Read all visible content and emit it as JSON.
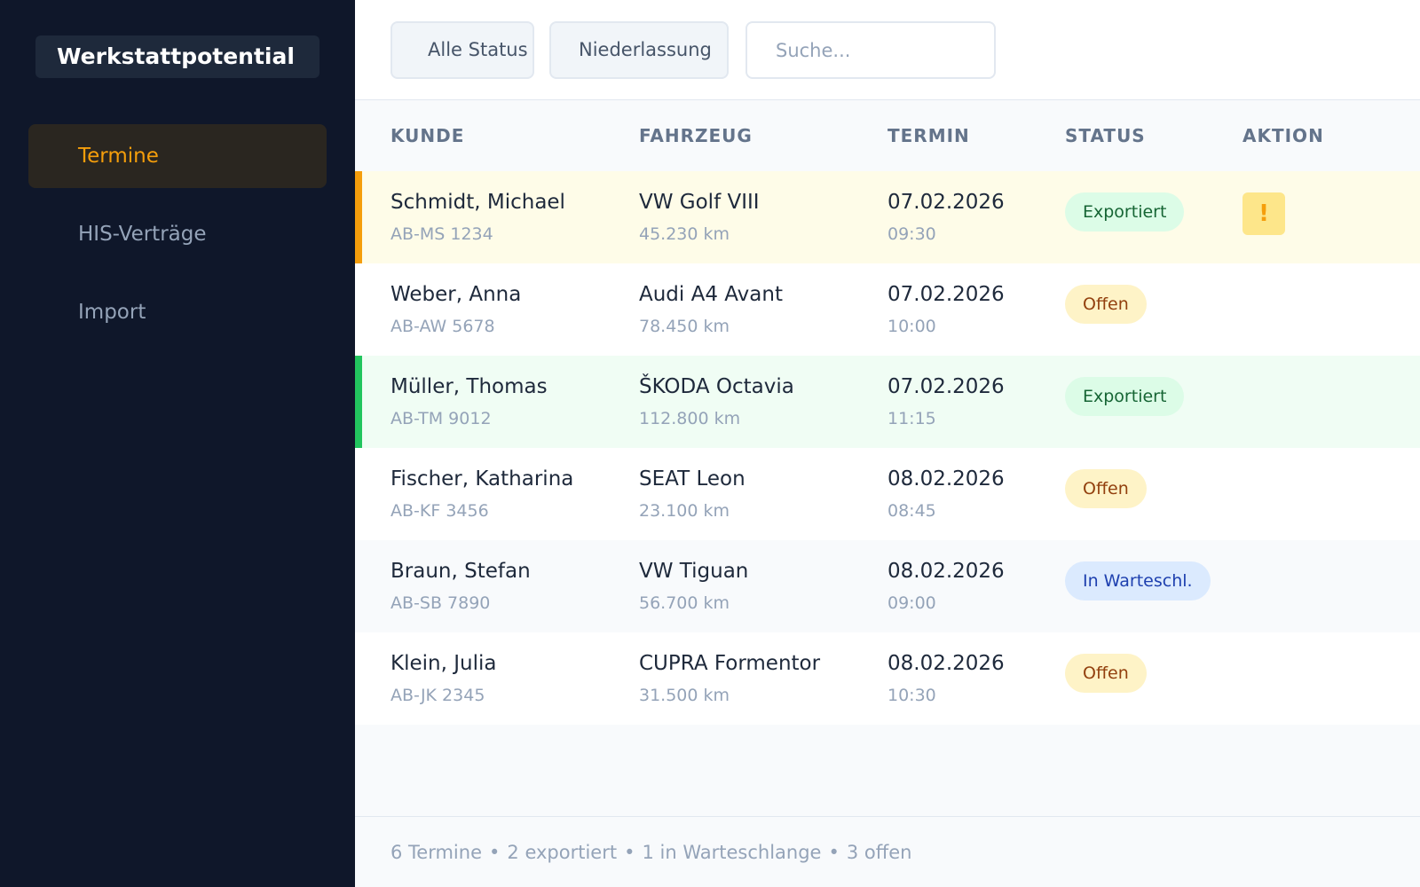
{
  "sidebar": {
    "brand": "Werkstattpotential",
    "items": [
      {
        "label": "Termine",
        "active": true
      },
      {
        "label": "HIS-Verträge",
        "active": false
      },
      {
        "label": "Import",
        "active": false
      }
    ]
  },
  "toolbar": {
    "status_filter": "Alle Status",
    "branch_filter": "Niederlassung",
    "search_placeholder": "Suche..."
  },
  "table": {
    "columns": [
      "KUNDE",
      "FAHRZEUG",
      "TERMIN",
      "STATUS",
      "AKTION"
    ],
    "rows": [
      {
        "name": "Schmidt, Michael",
        "plate": "AB-MS 1234",
        "vehicle": "VW Golf VIII",
        "mileage": "45.230 km",
        "date": "07.02.2026",
        "time": "09:30",
        "status": "Exportiert",
        "action": "!"
      },
      {
        "name": "Weber, Anna",
        "plate": "AB-AW 5678",
        "vehicle": "Audi A4 Avant",
        "mileage": "78.450 km",
        "date": "07.02.2026",
        "time": "10:00",
        "status": "Offen",
        "action": ""
      },
      {
        "name": "Müller, Thomas",
        "plate": "AB-TM 9012",
        "vehicle": "ŠKODA Octavia",
        "mileage": "112.800 km",
        "date": "07.02.2026",
        "time": "11:15",
        "status": "Exportiert",
        "action": ""
      },
      {
        "name": "Fischer, Katharina",
        "plate": "AB-KF 3456",
        "vehicle": "SEAT Leon",
        "mileage": "23.100 km",
        "date": "08.02.2026",
        "time": "08:45",
        "status": "Offen",
        "action": ""
      },
      {
        "name": "Braun, Stefan",
        "plate": "AB-SB 7890",
        "vehicle": "VW Tiguan",
        "mileage": "56.700 km",
        "date": "08.02.2026",
        "time": "09:00",
        "status": "In Warteschl.",
        "action": ""
      },
      {
        "name": "Klein, Julia",
        "plate": "AB-JK 2345",
        "vehicle": "CUPRA Formentor",
        "mileage": "31.500 km",
        "date": "08.02.2026",
        "time": "10:30",
        "status": "Offen",
        "action": ""
      }
    ]
  },
  "footer": {
    "total": "6 Termine",
    "exported": "2 exportiert",
    "queued": "1 in Warteschlange",
    "open": "3 offen",
    "separator": "•"
  },
  "colors": {
    "sidebar_bg": "#0f172a",
    "accent": "#f59e0b",
    "warn_bar": "#f59e0b",
    "done_bar": "#22c55e"
  }
}
